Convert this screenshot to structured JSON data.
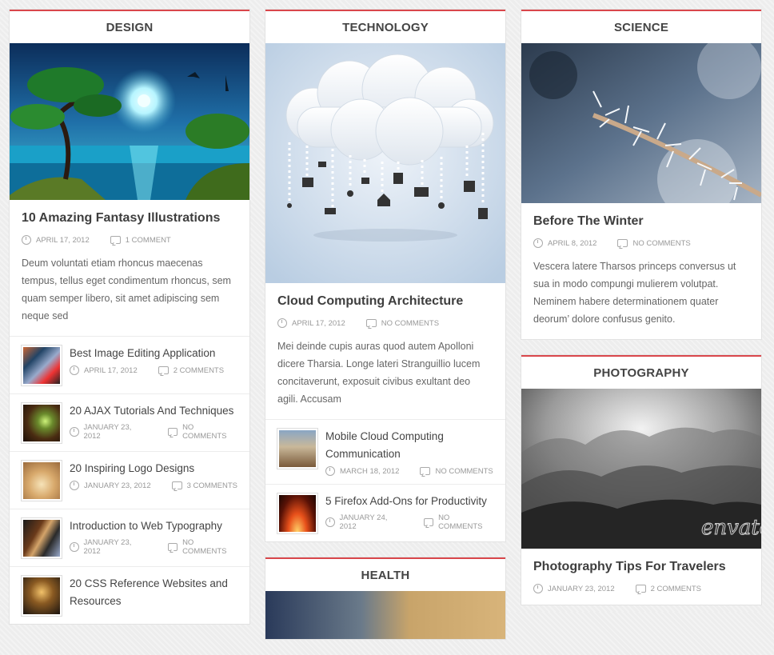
{
  "columns": [
    {
      "category": "DESIGN",
      "featured": {
        "title": "10 Amazing Fantasy Illustrations",
        "date": "APRIL 17, 2012",
        "comments": "1 COMMENT",
        "excerpt": "Deum voluntati etiam rhoncus maecenas tempus, tellus eget condimentum rhoncus, sem quam semper libero, sit amet adipiscing sem neque sed"
      },
      "items": [
        {
          "title": "Best Image Editing Application",
          "date": "APRIL 17, 2012",
          "comments": "2 COMMENTS"
        },
        {
          "title": "20 AJAX Tutorials And Techniques",
          "date": "JANUARY 23, 2012",
          "comments": "NO COMMENTS"
        },
        {
          "title": "20 Inspiring Logo Designs",
          "date": "JANUARY 23, 2012",
          "comments": "3 COMMENTS"
        },
        {
          "title": "Introduction to Web Typography",
          "date": "JANUARY 23, 2012",
          "comments": "NO COMMENTS"
        },
        {
          "title": "20 CSS Reference Websites and Resources",
          "date": "",
          "comments": ""
        }
      ]
    },
    {
      "category": "TECHNOLOGY",
      "featured": {
        "title": "Cloud Computing Architecture",
        "date": "APRIL 17, 2012",
        "comments": "NO COMMENTS",
        "excerpt": "Mei deinde cupis auras quod autem Apolloni dicere Tharsia. Longe lateri Stranguillio lucem concitaverunt, exposuit civibus exultant deo agili. Accusam"
      },
      "items": [
        {
          "title": "Mobile Cloud Computing Communication",
          "date": "MARCH 18, 2012",
          "comments": "NO COMMENTS"
        },
        {
          "title": "5 Firefox Add-Ons for Productivity",
          "date": "JANUARY 24, 2012",
          "comments": "NO COMMENTS"
        }
      ],
      "next_category": "HEALTH"
    },
    {
      "category": "SCIENCE",
      "featured": {
        "title": "Before The Winter",
        "date": "APRIL 8, 2012",
        "comments": "NO COMMENTS",
        "excerpt": "Vescera latere Tharsos princeps conversus ut sua in modo compungi mulierem volutpat. Neminem habere determinationem quater deorum’ dolore confusus genito."
      },
      "second": {
        "category": "PHOTOGRAPHY",
        "title": "Photography Tips For Travelers",
        "date": "JANUARY 23, 2012",
        "comments": "2 COMMENTS",
        "watermark": "envato"
      }
    }
  ]
}
